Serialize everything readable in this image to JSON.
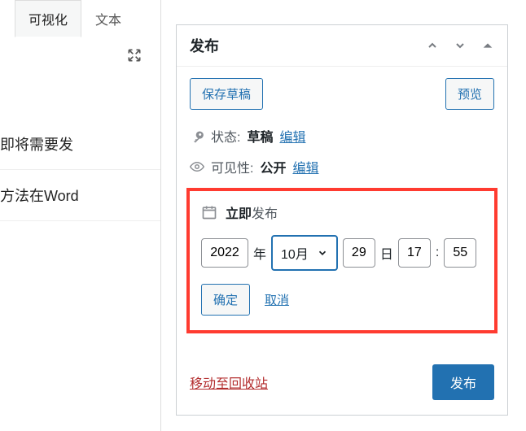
{
  "tabs": {
    "visual": "可视化",
    "text": "文本"
  },
  "left_items": {
    "a": "即将需要发",
    "b": "方法在Word"
  },
  "panel": {
    "title": "发布",
    "save_draft": "保存草稿",
    "preview": "预览",
    "status_label": "状态:",
    "status_value": "草稿",
    "status_edit": "编辑",
    "visibility_label": "可见性:",
    "visibility_value": "公开",
    "visibility_edit": "编辑",
    "schedule_bold": "立即",
    "schedule_rest": "发布",
    "date": {
      "year": "2022",
      "year_suffix": "年",
      "month": "10月",
      "day": "29",
      "day_suffix": "日",
      "hour": "17",
      "colon": ":",
      "minute": "55"
    },
    "ok": "确定",
    "cancel": "取消",
    "trash": "移动至回收站",
    "publish": "发布"
  }
}
